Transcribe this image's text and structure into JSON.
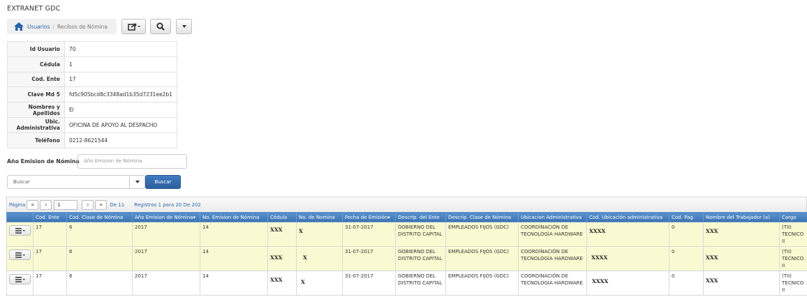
{
  "app_title": "EXTRANET GDC",
  "breadcrumb": {
    "link": "Usuarios",
    "separator": "/",
    "current": "Recibos de Nómina"
  },
  "user_info": [
    {
      "label": "Id Usuario",
      "value": "70"
    },
    {
      "label": "Cédula",
      "value": "1"
    },
    {
      "label": "Cod. Ente",
      "value": "17"
    },
    {
      "label": "Clave Md 5",
      "value": "fd5c905bcd8c3348ad1b35d7231ee2b1"
    },
    {
      "label": "Nombres y Apellidos",
      "value": "El"
    },
    {
      "label": "Ubic. Administrativa",
      "value": "OFICINA DE APOYO AL DESPACHO"
    },
    {
      "label": "Teléfono",
      "value": "0212-8621544"
    }
  ],
  "filter": {
    "anio_label": "Año Emision de Nómina",
    "anio_placeholder": "Año Emision de Nómina",
    "select_value": "Buscar",
    "search_button": "Buscar"
  },
  "pager": {
    "label": "Página",
    "page": "1",
    "of_text": "De 11",
    "records": "Registros 1 para 20 De 202"
  },
  "grid": {
    "columns": [
      "",
      "Cod. Ente",
      "Cod. Clase de Nómina",
      "Año Emision de Nómina▾",
      "No. Emision de Nómina",
      "Cédula",
      "No. de Nomina",
      "Fecha de Emisión▾",
      "Descrip. del Ente",
      "Descrip. Clase de Nómina",
      "Ubicacion Administrativa",
      "Cod. Ubicación administrativa",
      "Cod. Pag.",
      "Nombre del Trabajador (a)",
      "Cargo"
    ],
    "rows": [
      {
        "cod_ente": "17",
        "cod_clase": "6",
        "anio": "2017",
        "no_emision": "14",
        "cedula": "XXX",
        "no_nomina": "X",
        "fecha": "31-07-2017",
        "ente": "GOBIERNO DEL DISTRITO CAPITAL",
        "clase": "EMPLEADOS FIJOS (GDC)",
        "ubicacion": "COORDINACIÓN DE TECNOLOGÍA HARDWARE",
        "cod_ubic": "XXXX",
        "cod_pag": "0",
        "nombre": "XXX",
        "cargo": "(TII) TECNICO II"
      },
      {
        "cod_ente": "17",
        "cod_clase": "6",
        "anio": "2017",
        "no_emision": "14",
        "cedula": "XXX",
        "no_nomina": "X",
        "fecha": "31-07-2017",
        "ente": "GOBIERNO DEL DISTRITO CAPITAL",
        "clase": "EMPLEADOS FIJOS (GDC)",
        "ubicacion": "COORDINACIÓN DE TECNOLOGÍA HARDWARE",
        "cod_ubic": "XXXX",
        "cod_pag": "0",
        "nombre": "XXX",
        "cargo": "(TII) TECNICO II"
      },
      {
        "cod_ente": "17",
        "cod_clase": "6",
        "anio": "2017",
        "no_emision": "14",
        "cedula": "XXX",
        "no_nomina": "X",
        "fecha": "31-07-2017",
        "ente": "GOBIERNO DEL DISTRITO CAPITAL",
        "clase": "EMPLEADOS FIJOS (GDC)",
        "ubicacion": "COORDINACIÓN DE TECNOLOGÍA HARDWARE",
        "cod_ubic": "XXXX",
        "cod_pag": "0",
        "nombre": "XXX",
        "cargo": "(TII) TECNICO II"
      }
    ]
  },
  "colors": {
    "header_blue": "#4a83c2",
    "selected_row": "#fafad2",
    "link_blue": "#2a64a8"
  }
}
